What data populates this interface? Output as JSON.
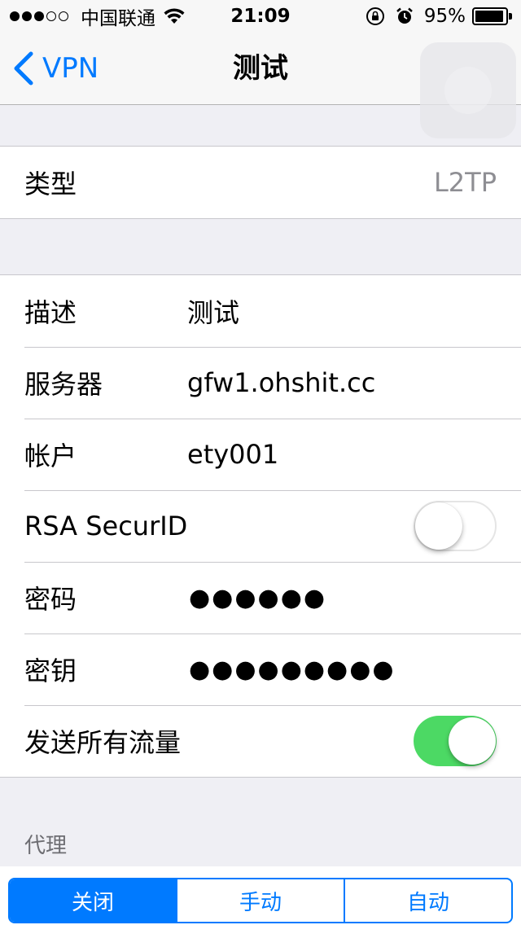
{
  "status_bar": {
    "carrier": "中国联通",
    "time": "21:09",
    "battery": "95%",
    "battery_level": 0.95,
    "signal_bars_filled": 3,
    "signal_bars_total": 5,
    "icons": [
      "wifi-icon",
      "rotation-lock-icon",
      "alarm-icon",
      "battery-icon"
    ]
  },
  "nav": {
    "back_label": "VPN",
    "title": "测试"
  },
  "type_group": {
    "label": "类型",
    "value": "L2TP"
  },
  "config": {
    "description": {
      "label": "描述",
      "value": "测试"
    },
    "server": {
      "label": "服务器",
      "value": "gfw1.ohshit.cc"
    },
    "account": {
      "label": "帐户",
      "value": "ety001"
    },
    "rsa": {
      "label": "RSA SecurID",
      "enabled": false
    },
    "password": {
      "label": "密码",
      "value": "●●●●●●"
    },
    "secret": {
      "label": "密钥",
      "value": "●●●●●●●●●"
    },
    "send_all_traffic": {
      "label": "发送所有流量",
      "enabled": true
    }
  },
  "proxy": {
    "header": "代理",
    "options": [
      "关闭",
      "手动",
      "自动"
    ],
    "selected": "关闭"
  },
  "colors": {
    "accent": "#007aff",
    "switch_on": "#4cd964",
    "background": "#efeff4",
    "separator": "#c8c7cc",
    "secondary_text": "#8e8e93"
  }
}
